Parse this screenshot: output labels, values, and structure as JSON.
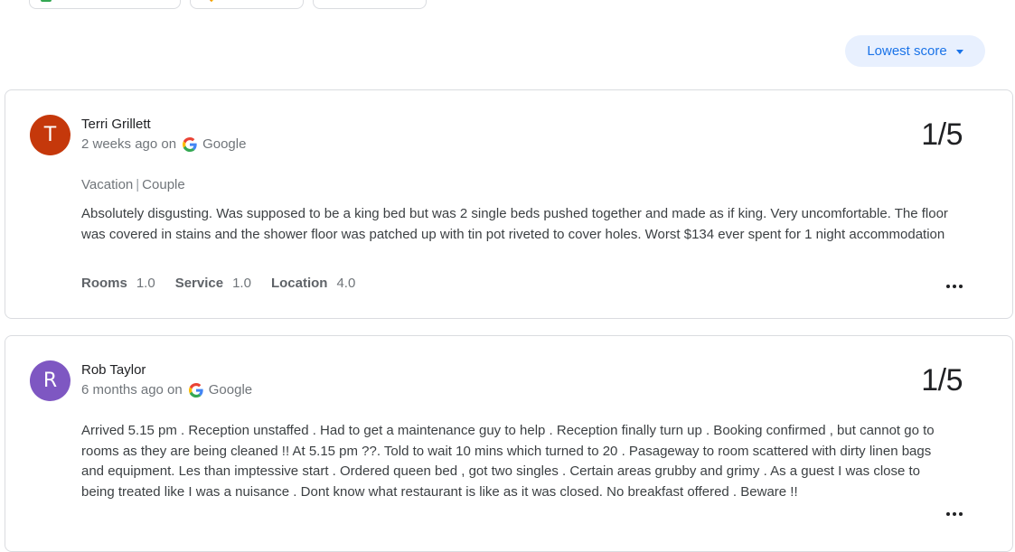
{
  "sort": {
    "label": "Lowest score"
  },
  "reviews": [
    {
      "author": "Terri Grillett",
      "avatar_letter": "T",
      "avatar_color": "#c5380b",
      "date": "2 weeks ago on",
      "source": "Google",
      "score": "1/5",
      "trip_type": "Vacation",
      "trip_separator": "|",
      "companions": "Couple",
      "text": "Absolutely disgusting. Was supposed to be a king bed but was 2 single beds pushed together and made as if king. Very uncomfortable. The floor was covered in stains and the shower floor was patched up with tin pot riveted to cover holes. Worst $134 ever spent for 1 night accommodation",
      "ratings": [
        {
          "label": "Rooms",
          "value": "1.0"
        },
        {
          "label": "Service",
          "value": "1.0"
        },
        {
          "label": "Location",
          "value": "4.0"
        }
      ]
    },
    {
      "author": "Rob Taylor",
      "avatar_letter": "R",
      "avatar_color": "#7e57c2",
      "date": "6 months ago on",
      "source": "Google",
      "score": "1/5",
      "text": "Arrived 5.15 pm . Reception unstaffed . Had to get a maintenance guy to help . Reception finally turn up . Booking confirmed , but cannot go to rooms as they are being cleaned !! At 5.15 pm ??. Told to wait 10 mins which turned to 20 . Pasageway to room scattered with dirty linen bags and equipment. Les than imptessive start . Ordered queen bed , got two singles . Certain areas grubby and grimy . As a guest I was close to being treated like I was a nuisance . Dont know what restaurant is like as it was closed. No breakfast offered . Beware !!"
    }
  ],
  "colors": {
    "accent": "#1a73e8",
    "accent_bg": "#e8f0fe",
    "border": "#dadce0"
  }
}
